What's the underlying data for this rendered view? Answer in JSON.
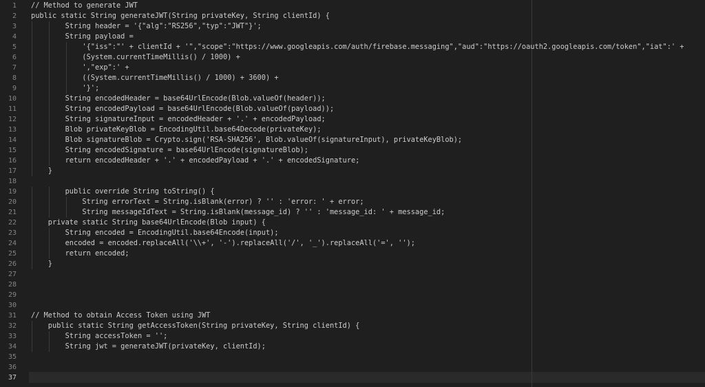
{
  "editor": {
    "active_line": 37,
    "lines": [
      {
        "n": "1",
        "text": "// Method to generate JWT"
      },
      {
        "n": "2",
        "text": "public static String generateJWT(String privateKey, String clientId) {"
      },
      {
        "n": "3",
        "text": "        String header = '{\"alg\":\"RS256\",\"typ\":\"JWT\"}';"
      },
      {
        "n": "4",
        "text": "        String payload ="
      },
      {
        "n": "5",
        "text": "            '{\"iss\":\"' + clientId + '\",\"scope\":\"https://www.googleapis.com/auth/firebase.messaging\",\"aud\":\"https://oauth2.googleapis.com/token\",\"iat\":' +"
      },
      {
        "n": "6",
        "text": "            (System.currentTimeMillis() / 1000) +"
      },
      {
        "n": "7",
        "text": "            ',\"exp\":' +"
      },
      {
        "n": "8",
        "text": "            ((System.currentTimeMillis() / 1000) + 3600) +"
      },
      {
        "n": "9",
        "text": "            '}';"
      },
      {
        "n": "10",
        "text": "        String encodedHeader = base64UrlEncode(Blob.valueOf(header));"
      },
      {
        "n": "11",
        "text": "        String encodedPayload = base64UrlEncode(Blob.valueOf(payload));"
      },
      {
        "n": "12",
        "text": "        String signatureInput = encodedHeader + '.' + encodedPayload;"
      },
      {
        "n": "13",
        "text": "        Blob privateKeyBlob = EncodingUtil.base64Decode(privateKey);"
      },
      {
        "n": "14",
        "text": "        Blob signatureBlob = Crypto.sign('RSA-SHA256', Blob.valueOf(signatureInput), privateKeyBlob);"
      },
      {
        "n": "15",
        "text": "        String encodedSignature = base64UrlEncode(signatureBlob);"
      },
      {
        "n": "16",
        "text": "        return encodedHeader + '.' + encodedPayload + '.' + encodedSignature;"
      },
      {
        "n": "17",
        "text": "    }"
      },
      {
        "n": "18",
        "text": ""
      },
      {
        "n": "19",
        "text": "        public override String toString() {"
      },
      {
        "n": "20",
        "text": "            String errorText = String.isBlank(error) ? '' : 'error: ' + error;"
      },
      {
        "n": "21",
        "text": "            String messageIdText = String.isBlank(message_id) ? '' : 'message_id: ' + message_id;"
      },
      {
        "n": "22",
        "text": "    private static String base64UrlEncode(Blob input) {"
      },
      {
        "n": "23",
        "text": "        String encoded = EncodingUtil.base64Encode(input);"
      },
      {
        "n": "24",
        "text": "        encoded = encoded.replaceAll('\\\\+', '-').replaceAll('/', '_').replaceAll('=', '');"
      },
      {
        "n": "25",
        "text": "        return encoded;"
      },
      {
        "n": "26",
        "text": "    }"
      },
      {
        "n": "27",
        "text": ""
      },
      {
        "n": "28",
        "text": ""
      },
      {
        "n": "29",
        "text": ""
      },
      {
        "n": "30",
        "text": ""
      },
      {
        "n": "31",
        "text": "// Method to obtain Access Token using JWT"
      },
      {
        "n": "32",
        "text": "    public static String getAccessToken(String privateKey, String clientId) {"
      },
      {
        "n": "33",
        "text": "        String accessToken = '';"
      },
      {
        "n": "34",
        "text": "        String jwt = generateJWT(privateKey, clientId);"
      },
      {
        "n": "35",
        "text": ""
      },
      {
        "n": "36",
        "text": ""
      },
      {
        "n": "37",
        "text": ""
      }
    ]
  }
}
